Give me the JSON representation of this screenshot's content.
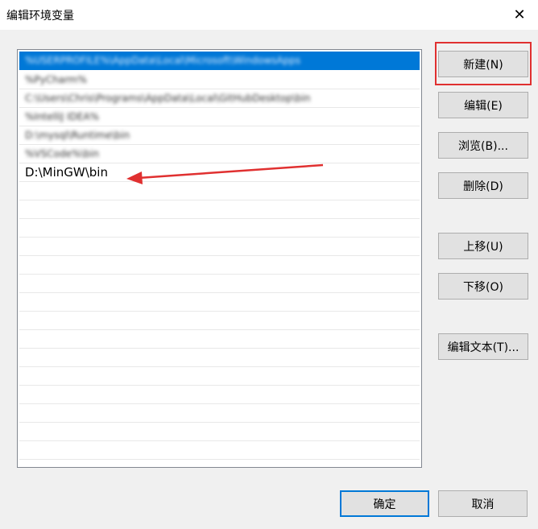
{
  "window": {
    "title": "编辑环境变量",
    "close_glyph": "✕"
  },
  "list": {
    "items": [
      {
        "text": "%USERPROFILE%\\AppData\\Local\\Microsoft\\WindowsApps",
        "blurred": true,
        "selected": true
      },
      {
        "text": "%PyCharm%",
        "blurred": true,
        "selected": false
      },
      {
        "text": "C:\\Users\\Chris\\Programs\\AppData\\Local\\GitHubDesktop\\bin",
        "blurred": true,
        "selected": false
      },
      {
        "text": "%IntelliJ IDEA%",
        "blurred": true,
        "selected": false
      },
      {
        "text": "D:\\mysql\\Runtime\\bin",
        "blurred": true,
        "selected": false
      },
      {
        "text": "%VSCode%\\bin",
        "blurred": true,
        "selected": false
      },
      {
        "text": "D:\\MinGW\\bin",
        "blurred": false,
        "selected": false
      }
    ],
    "empty_rows": 15
  },
  "buttons": {
    "new": "新建(N)",
    "edit": "编辑(E)",
    "browse": "浏览(B)...",
    "delete": "删除(D)",
    "move_up": "上移(U)",
    "move_down": "下移(O)",
    "edit_text": "编辑文本(T)...",
    "ok": "确定",
    "cancel": "取消"
  },
  "annotations": {
    "highlight_color": "#e03030",
    "arrow_color": "#e03030"
  }
}
